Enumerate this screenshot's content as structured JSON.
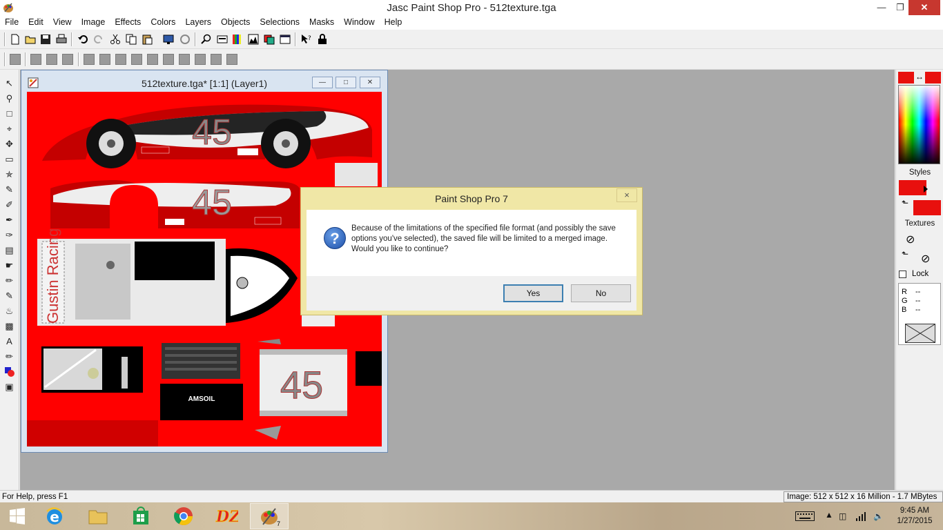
{
  "app": {
    "title": "Jasc Paint Shop Pro - 512texture.tga"
  },
  "menu": [
    "File",
    "Edit",
    "View",
    "Image",
    "Effects",
    "Colors",
    "Layers",
    "Objects",
    "Selections",
    "Masks",
    "Window",
    "Help"
  ],
  "image_window": {
    "title": "512texture.tga* [1:1] (Layer1)",
    "texture_number": "45",
    "side_text": "Gustin Racing"
  },
  "dialog": {
    "title": "Paint Shop Pro 7",
    "message": "Because of the limitations of the specified file format (and possibly the save options you've selected), the saved file will be limited to a merged image. Would you like to continue?",
    "yes_label": "Yes",
    "no_label": "No",
    "close_glyph": "×"
  },
  "right_panel": {
    "styles_label": "Styles",
    "textures_label": "Textures",
    "lock_label": "Lock",
    "rgb": [
      {
        "channel": "R",
        "value": "--"
      },
      {
        "channel": "G",
        "value": "--"
      },
      {
        "channel": "B",
        "value": "--"
      }
    ],
    "foreground_color": "#e8100e",
    "background_color": "#e8100e"
  },
  "statusbar": {
    "help_text": "For Help, press F1",
    "image_info": "Image:  512 x 512 x 16 Million - 1.7 MBytes"
  },
  "taskbar": {
    "time": "9:45 AM",
    "date": "1/27/2015",
    "items": [
      "start",
      "internet-explorer",
      "file-explorer",
      "store",
      "chrome",
      "dz-app",
      "paint-shop-pro"
    ],
    "psp_badge": "7"
  }
}
